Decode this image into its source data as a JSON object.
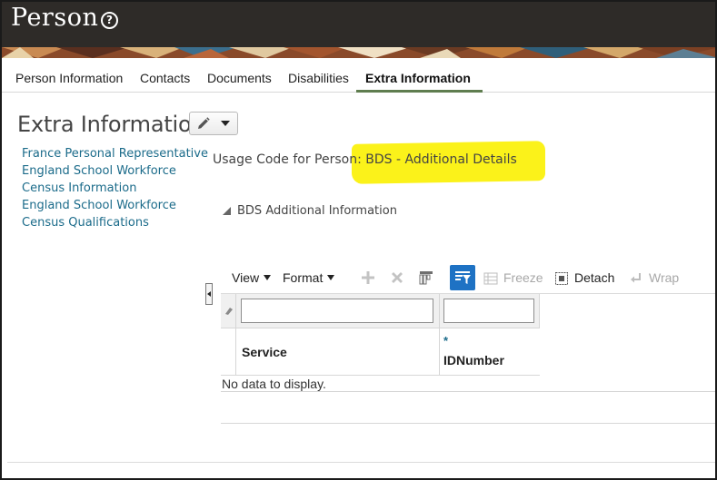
{
  "header": {
    "title": "Person",
    "help_icon": "help-circle-icon"
  },
  "tabs": [
    {
      "label": "Person Information",
      "active": false
    },
    {
      "label": "Contacts",
      "active": false
    },
    {
      "label": "Documents",
      "active": false
    },
    {
      "label": "Disabilities",
      "active": false
    },
    {
      "label": "Extra Information",
      "active": true
    }
  ],
  "main": {
    "title": "Extra Information",
    "edit_icon": "pencil-icon"
  },
  "side_links": [
    "France Personal Representative",
    "England School Workforce",
    "Census Information",
    "England School Workforce",
    "Census Qualifications"
  ],
  "usage": {
    "label": "Usage Code for Person:",
    "value": "BDS - Additional Details",
    "highlight_color": "#fbf21a"
  },
  "subsection": {
    "title": "BDS Additional Information"
  },
  "toolbar": {
    "view_label": "View",
    "format_label": "Format",
    "freeze_label": "Freeze",
    "detach_label": "Detach",
    "wrap_label": "Wrap",
    "accent_color": "#1e72c4"
  },
  "table": {
    "columns": [
      {
        "label": "Service",
        "required": false
      },
      {
        "label": "IDNumber",
        "required": true
      }
    ],
    "required_marker": "*",
    "empty_text": "No data to display."
  },
  "colors": {
    "header_bg": "#2e2b28",
    "link": "#1b6b8a",
    "tab_underline": "#5f7d4f"
  }
}
